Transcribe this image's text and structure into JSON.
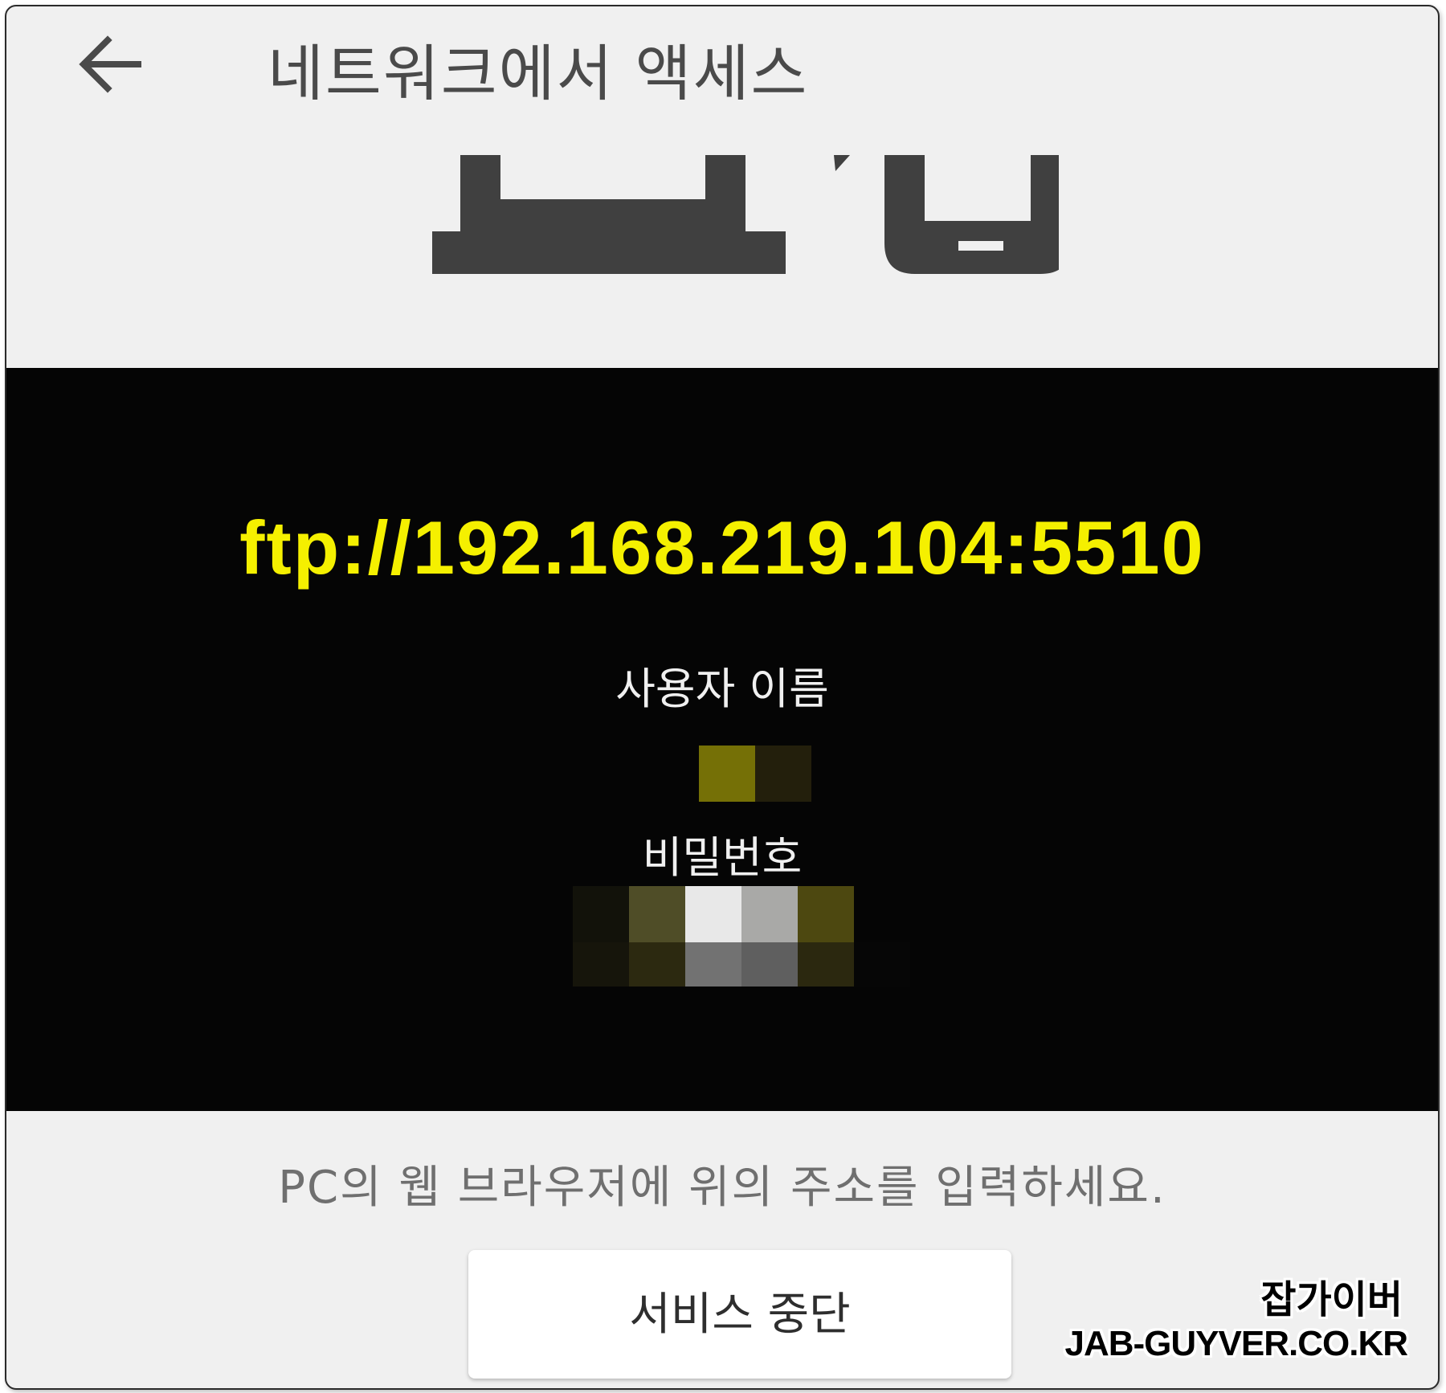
{
  "header": {
    "title": "네트워크에서 액세스",
    "back_icon": "arrow-left-icon"
  },
  "illustration": {
    "icon": "pc-and-phone-icon",
    "color": "#404040"
  },
  "connection": {
    "address": "ftp://192.168.219.104:5510",
    "address_color": "#f5f000",
    "username_label": "사용자 이름",
    "password_label": "비밀번호"
  },
  "footer": {
    "hint": "PC의 웹 브라우저에 위의 주소를 입력하세요.",
    "stop_button": "서비스 중단"
  },
  "watermark": {
    "line1": "잡가이버",
    "line2": "JAB-GUYVER.CO.KR"
  }
}
